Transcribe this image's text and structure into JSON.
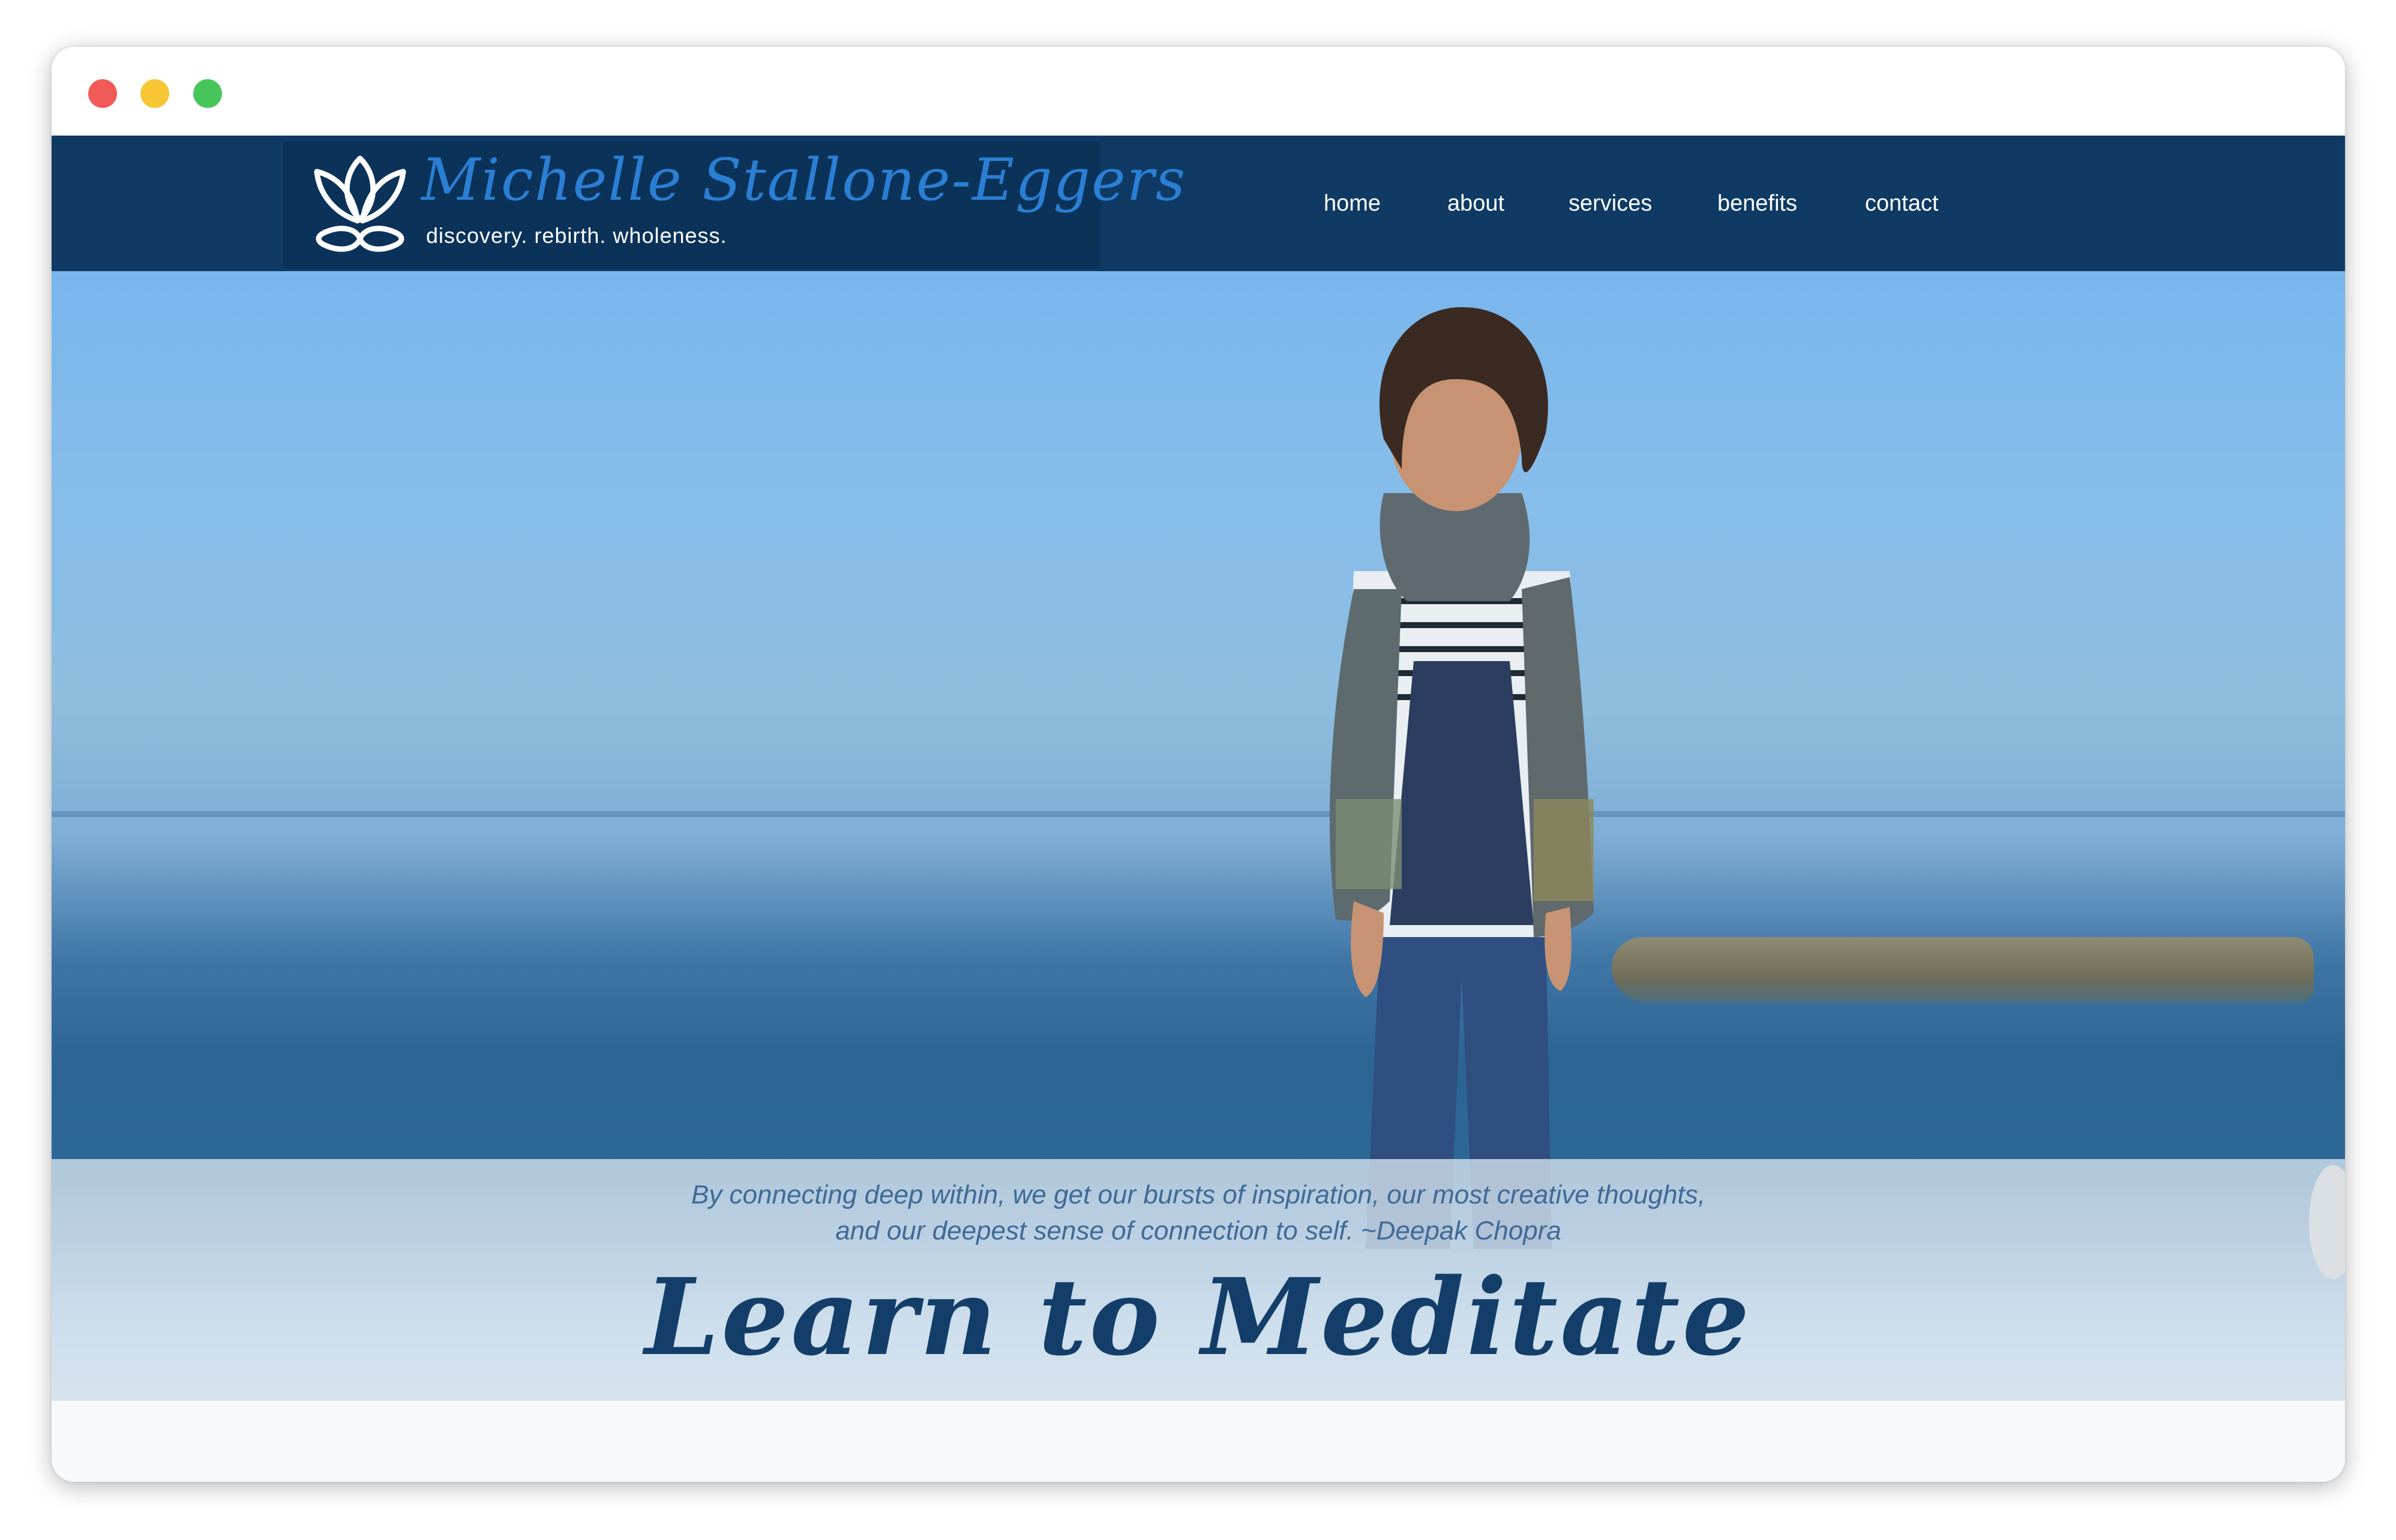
{
  "window": {
    "controls": [
      "close",
      "minimize",
      "maximize"
    ]
  },
  "header": {
    "brand_name": "Michelle Stallone-Eggers",
    "tagline": "discovery. rebirth. wholeness.",
    "logo_icon": "lotus-icon"
  },
  "nav": {
    "items": [
      {
        "label": "home"
      },
      {
        "label": "about"
      },
      {
        "label": "services"
      },
      {
        "label": "benefits"
      },
      {
        "label": "contact"
      }
    ]
  },
  "hero": {
    "quote_line1": "By connecting deep within, we get our bursts of inspiration, our most creative thoughts,",
    "quote_line2": "and our deepest sense of connection to self. ~Deepak Chopra",
    "headline": "Learn to Meditate"
  },
  "colors": {
    "navbar": "#0e3a63",
    "brand_name": "#2a7fd4",
    "headline": "#133e69",
    "quote": "#3e6a97"
  }
}
